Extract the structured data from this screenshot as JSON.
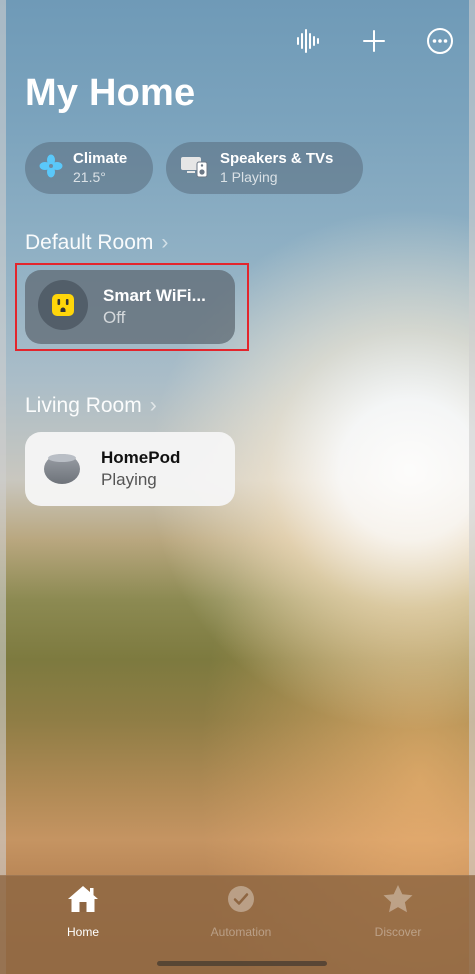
{
  "toolbar": {
    "icons": [
      "waveform-icon",
      "add-icon",
      "more-options-icon"
    ]
  },
  "page": {
    "title": "My Home"
  },
  "chips": [
    {
      "title": "Climate",
      "subtitle": "21.5°",
      "icon": "fan-icon",
      "icon_color": "#5ac8fa"
    },
    {
      "title": "Speakers & TVs",
      "subtitle": "1 Playing",
      "icon": "speaker-tv-icon"
    }
  ],
  "rooms": [
    {
      "name": "Default Room",
      "accessories": [
        {
          "name": "Smart WiFi...",
          "state": "Off",
          "icon": "outlet-icon",
          "icon_color": "#ffd60a"
        }
      ]
    },
    {
      "name": "Living Room",
      "accessories": [
        {
          "name": "HomePod",
          "state": "Playing",
          "icon": "homepod-icon"
        }
      ]
    }
  ],
  "tabs": [
    {
      "label": "Home",
      "icon": "house-icon",
      "active": true
    },
    {
      "label": "Automation",
      "icon": "clock-check-icon",
      "active": false
    },
    {
      "label": "Discover",
      "icon": "star-icon",
      "active": false
    }
  ],
  "colors": {
    "highlight": "#e3252c",
    "accent_yellow": "#ffd60a",
    "climate_blue": "#5ac8fa"
  }
}
